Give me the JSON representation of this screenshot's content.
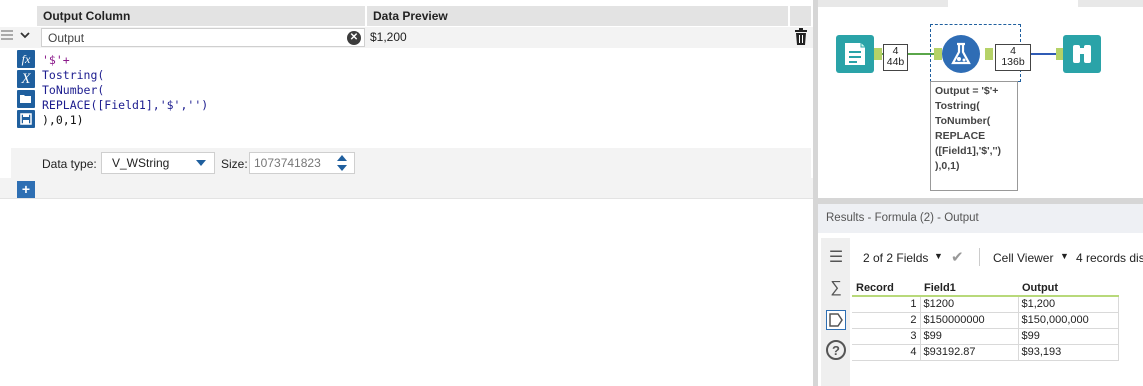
{
  "formula_config": {
    "headers": {
      "output_column": "Output Column",
      "data_preview": "Data Preview"
    },
    "row": {
      "output_field": "Output",
      "preview_value": "$1,200",
      "expression_lines": [
        "'$'+",
        "Tostring(",
        "ToNumber(",
        "REPLACE([Field1],'$','')",
        "),0,1)"
      ]
    },
    "data_type_label": "Data type:",
    "data_type_value": "V_WString",
    "size_label": "Size:",
    "size_value": "1073741823"
  },
  "canvas": {
    "input_count": "4",
    "input_size": "44b",
    "output_count": "4",
    "output_size": "136b",
    "annotation": "Output = '$'+\nTostring(\nToNumber(\nREPLACE\n([Field1],'$','')\n),0,1)"
  },
  "results": {
    "title": "Results - Formula (2) - Output",
    "fields_label": "2 of 2 Fields",
    "viewer_label": "Cell Viewer",
    "records_label": "4 records dis",
    "columns": [
      "Record",
      "Field1",
      "Output"
    ],
    "rows": [
      {
        "record": "1",
        "field1": "$1200",
        "output": "$1,200"
      },
      {
        "record": "2",
        "field1": "$150000000",
        "output": "$150,000,000"
      },
      {
        "record": "3",
        "field1": "$99",
        "output": "$99"
      },
      {
        "record": "4",
        "field1": "$93192.87",
        "output": "$93,193"
      }
    ]
  },
  "icons": [
    "grip-icon",
    "chevron-down-icon",
    "clear-icon",
    "trash-icon",
    "function-icon",
    "variable-icon",
    "open-folder-icon",
    "save-icon",
    "add-icon",
    "input-data-tool-icon",
    "formula-tool-icon",
    "browse-tool-icon",
    "metadata-icon",
    "summation-icon",
    "data-icon",
    "help-icon",
    "check-icon"
  ],
  "colors": {
    "accent": "#1f5f9e",
    "tool_teal": "#2aa3a8",
    "connector_green": "#b5d267",
    "string_literal": "#8b1a8b"
  }
}
